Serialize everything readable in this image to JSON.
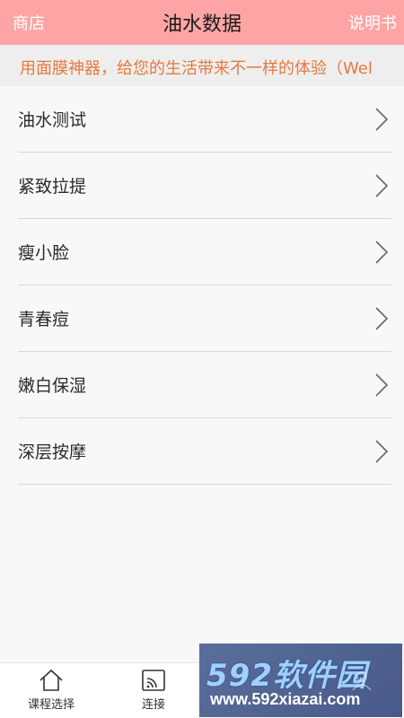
{
  "header": {
    "left_label": "商店",
    "title": "油水数据",
    "right_label": "说明书"
  },
  "marquee": {
    "text": "用面膜神器，给您的生活带来不一样的体验（Wel"
  },
  "list": {
    "items": [
      {
        "label": "油水测试"
      },
      {
        "label": "紧致拉提"
      },
      {
        "label": "瘦小脸"
      },
      {
        "label": "青春痘"
      },
      {
        "label": "嫩白保湿"
      },
      {
        "label": "深层按摩"
      }
    ]
  },
  "tabbar": {
    "tabs": [
      {
        "label": "课程选择",
        "icon": "home-icon"
      },
      {
        "label": "连接",
        "icon": "cast-icon"
      }
    ]
  },
  "watermark": {
    "logo": "592软件园",
    "url": "www.592xiazai.com"
  },
  "colors": {
    "header_bg": "#ffa4a4",
    "marquee_text": "#e8783c",
    "page_bg": "#f8f8f8"
  }
}
